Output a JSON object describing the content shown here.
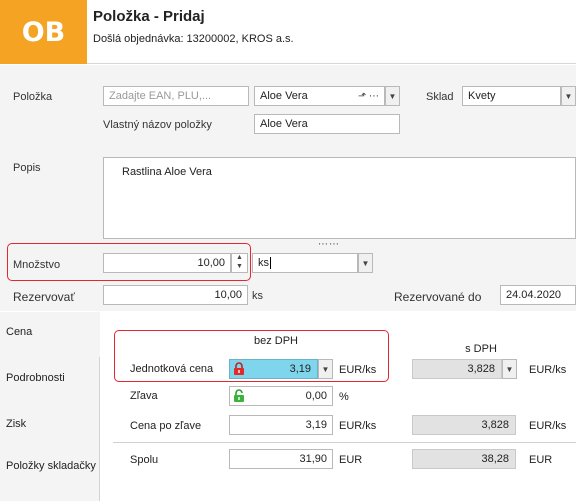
{
  "header": {
    "logo": "OB",
    "title": "Položka - Pridaj",
    "subtitle": "Došlá objednávka: 13200002, KROS a.s."
  },
  "form": {
    "polozka_label": "Položka",
    "ean_placeholder": "Zadajte EAN, PLU,...",
    "item_value": "Aloe Vera",
    "sklad_label": "Sklad",
    "sklad_value": "Kvety",
    "vlastny_label": "Vlastný názov položky",
    "vlastny_value": "Aloe Vera",
    "popis_label": "Popis",
    "popis_value": "Rastlina Aloe Vera",
    "mnozstvo_label": "Množstvo",
    "mnozstvo_value": "10,00",
    "unit_value": "ks",
    "rezervovat_label": "Rezervovať",
    "rezervovat_value": "10,00",
    "rezervovat_unit": "ks",
    "rezervovane_do_label": "Rezervované do",
    "rezervovane_do_value": "24.04.2020"
  },
  "tabs": [
    "Cena",
    "Podrobnosti",
    "Zisk",
    "Položky skladačky"
  ],
  "price": {
    "bez_dph": "bez DPH",
    "s_dph": "s DPH",
    "jednotkova_label": "Jednotková cena",
    "jednotkova_value": "3,19",
    "jednotkova_unit": "EUR/ks",
    "jednotkova_s_dph": "3,828",
    "jednotkova_s_unit": "EUR/ks",
    "zlava_label": "Zľava",
    "zlava_value": "0,00",
    "zlava_unit": "%",
    "cena_po_zlave_label": "Cena po zľave",
    "cena_po_zlave_value": "3,19",
    "cena_po_zlave_unit": "EUR/ks",
    "cena_po_zlave_s_dph": "3,828",
    "cena_po_zlave_s_unit": "EUR/ks",
    "spolu_label": "Spolu",
    "spolu_value": "31,90",
    "spolu_unit": "EUR",
    "spolu_s_dph": "38,28",
    "spolu_s_unit": "EUR"
  },
  "colors": {
    "brand": "#f5a323",
    "highlight": "#7fd6ec",
    "alert": "#e0282e"
  }
}
